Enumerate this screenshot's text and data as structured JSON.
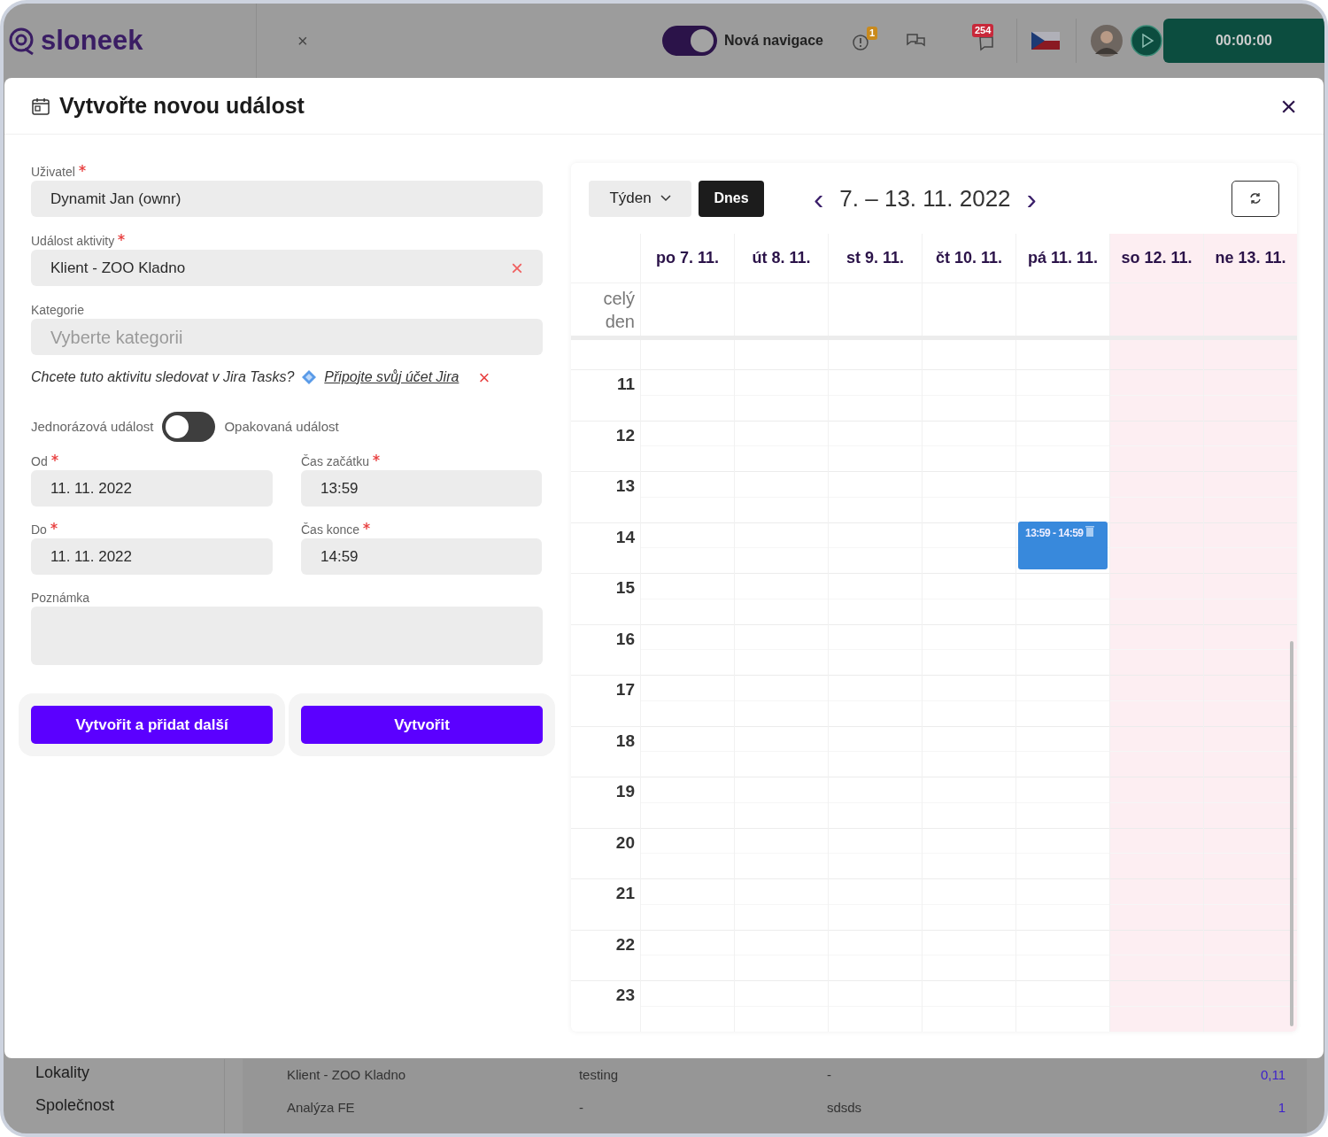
{
  "app_header": {
    "logo": "sloneek",
    "tab_close": "×",
    "navigation_toggle": {
      "label": "Nová navigace",
      "on": true
    },
    "alerts_badge": "1",
    "messages_badge": "254",
    "timer": "00:00:00"
  },
  "background": {
    "sidebar_items": [
      "Lokality",
      "Společnost"
    ],
    "rows": [
      [
        "Klient - ZOO Kladno",
        "testing",
        "-",
        "0,11"
      ],
      [
        "Analýza FE",
        "-",
        "sdsds",
        "1"
      ]
    ]
  },
  "modal": {
    "title": "Vytvořte novou událost",
    "close": "×",
    "fields": [
      {
        "label": "Uživatel",
        "required": true,
        "value": "Dynamit Jan (ownr)"
      },
      {
        "label": "Událost aktivity",
        "required": true,
        "value": "Klient - ZOO Kladno",
        "clear": "×"
      },
      {
        "label": "Kategorie",
        "required": false,
        "placeholder": "Vyberte kategorii"
      }
    ],
    "jira": {
      "question": "Chcete tuto aktivitu sledovat v Jira Tasks?",
      "link": "Připojte svůj účet Jira",
      "dismiss": "×"
    },
    "recurrence": {
      "left_label": "Jednorázová událost",
      "right_label": "Opakovaná událost",
      "on": false
    },
    "date_fields": [
      {
        "label": "Od",
        "required": true,
        "value": "11. 11. 2022"
      },
      {
        "label": "Čas začátku",
        "required": true,
        "value": "13:59"
      },
      {
        "label": "Do",
        "required": true,
        "value": "11. 11. 2022"
      },
      {
        "label": "Čas konce",
        "required": true,
        "value": "14:59"
      }
    ],
    "note": {
      "label": "Poznámka"
    },
    "buttons": [
      "Vytvořit a přidat další",
      "Vytvořit"
    ]
  },
  "calendar": {
    "view": "Týden",
    "today": "Dnes",
    "prev": "‹",
    "next": "›",
    "range": "7. – 13. 11. 2022",
    "all_day": "celý den",
    "days": [
      {
        "label": "po 7. 11.",
        "weekend": false
      },
      {
        "label": "út 8. 11.",
        "weekend": false
      },
      {
        "label": "st 9. 11.",
        "weekend": false
      },
      {
        "label": "čt 10. 11.",
        "weekend": false
      },
      {
        "label": "pá 11. 11.",
        "weekend": false,
        "events": [
          {
            "time": "13:59 - 14:59"
          }
        ]
      },
      {
        "label": "so 12. 11.",
        "weekend": true
      },
      {
        "label": "ne 13. 11.",
        "weekend": true
      }
    ],
    "hours": [
      "11",
      "12",
      "13",
      "14",
      "15",
      "16",
      "17",
      "18",
      "19",
      "20",
      "21",
      "22",
      "23"
    ]
  }
}
